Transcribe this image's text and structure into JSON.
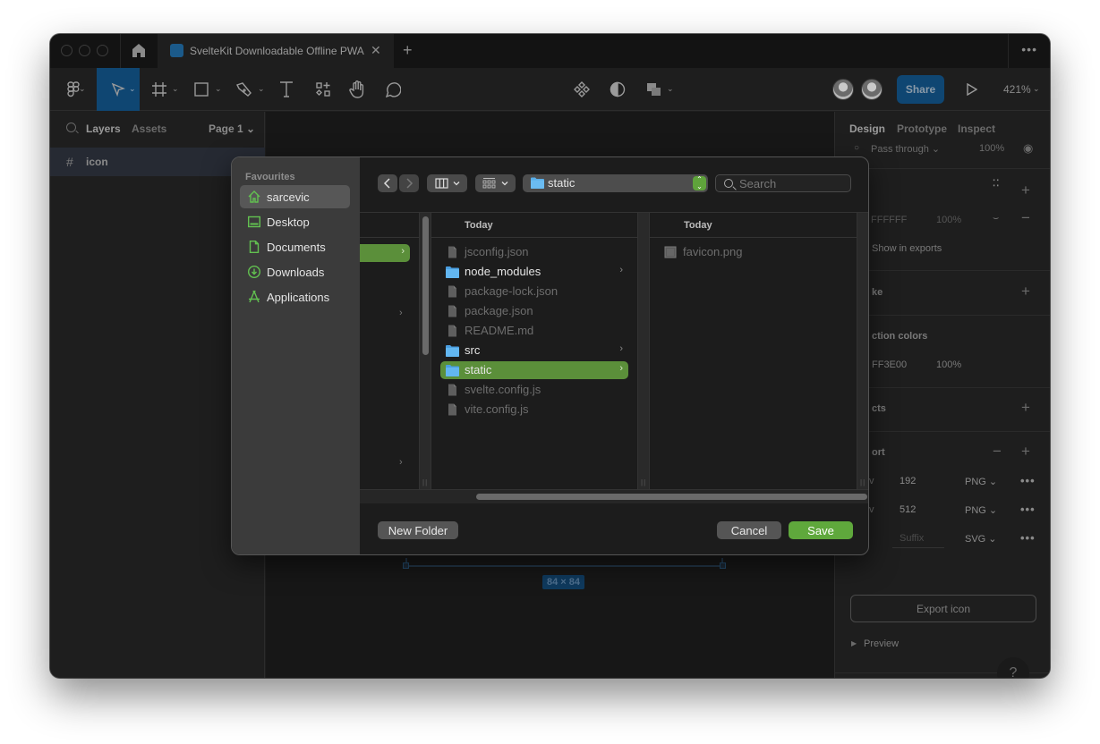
{
  "window": {
    "tab_title": "SvelteKit Downloadable Offline PWA",
    "tab_close": "✕",
    "tab_add": "+",
    "more": "•••"
  },
  "toolbar": {
    "share_label": "Share",
    "zoom_level": "421%"
  },
  "left_panel": {
    "tabs": [
      "Layers",
      "Assets"
    ],
    "page_selector": "Page 1 ⌄",
    "layers": [
      {
        "icon": "#",
        "name": "icon"
      }
    ]
  },
  "right_panel": {
    "tabs": [
      "Design",
      "Prototype",
      "Inspect"
    ],
    "layer_blend": "Pass through ⌄",
    "layer_opacity": "100%",
    "fill_hex": "FFFFFF",
    "fill_opacity": "100%",
    "show_in_exports": "Show in exports",
    "stroke_heading": "ke",
    "selection_colors_heading": "ction colors",
    "selection_color_hex": "FF3E00",
    "selection_color_opacity": "100%",
    "effects_heading": "cts",
    "export_heading": "ort",
    "exports": [
      {
        "scale_suffix": "v",
        "size": "192",
        "format": "PNG ⌄"
      },
      {
        "scale_suffix": "v",
        "size": "512",
        "format": "PNG ⌄"
      },
      {
        "scale_suffix": "",
        "size": "Suffix",
        "format": "SVG ⌄"
      }
    ],
    "export_button": "Export icon",
    "preview_label": "Preview",
    "help": "?"
  },
  "canvas": {
    "dimensions_label": "84 × 84"
  },
  "dialog": {
    "favourites_heading": "Favourites",
    "favourites": [
      {
        "label": "sarcevic",
        "icon": "home-icon",
        "selected": true
      },
      {
        "label": "Desktop",
        "icon": "desktop-icon",
        "selected": false
      },
      {
        "label": "Documents",
        "icon": "document-icon",
        "selected": false
      },
      {
        "label": "Downloads",
        "icon": "download-icon",
        "selected": false
      },
      {
        "label": "Applications",
        "icon": "applications-icon",
        "selected": false
      }
    ],
    "path_folder": "static",
    "search_placeholder": "Search",
    "columns": [
      {
        "heading": "Today",
        "items": [
          {
            "name": "jsconfig.json",
            "type": "file",
            "enabled": false
          },
          {
            "name": "node_modules",
            "type": "folder",
            "enabled": true
          },
          {
            "name": "package-lock.json",
            "type": "file",
            "enabled": false
          },
          {
            "name": "package.json",
            "type": "file",
            "enabled": false
          },
          {
            "name": "README.md",
            "type": "file",
            "enabled": false
          },
          {
            "name": "src",
            "type": "folder",
            "enabled": true
          },
          {
            "name": "static",
            "type": "folder",
            "enabled": true,
            "selected": true
          },
          {
            "name": "svelte.config.js",
            "type": "file",
            "enabled": false
          },
          {
            "name": "vite.config.js",
            "type": "file",
            "enabled": false
          }
        ]
      },
      {
        "heading": "Today",
        "items": [
          {
            "name": "favicon.png",
            "type": "image",
            "enabled": false
          }
        ]
      }
    ],
    "new_folder_button": "New Folder",
    "cancel_button": "Cancel",
    "save_button": "Save"
  },
  "colors": {
    "accent_green": "#5fa83c",
    "figma_blue": "#0f4672",
    "sidebar_icon_green": "#62c150"
  }
}
